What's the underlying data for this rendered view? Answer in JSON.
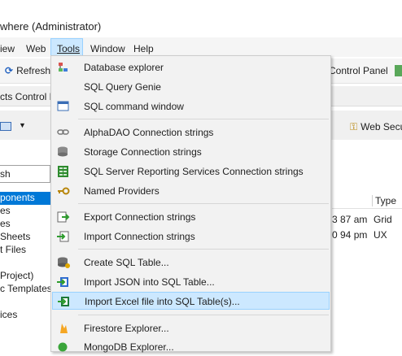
{
  "window": {
    "title": "where (Administrator)"
  },
  "menubar": {
    "items": [
      {
        "label": "iew"
      },
      {
        "label": "Web"
      },
      {
        "label": "Tools"
      },
      {
        "label": "Window"
      },
      {
        "label": "Help"
      }
    ]
  },
  "toolbar": {
    "refresh_label": "Refresh",
    "control_panel_label": "Control Panel"
  },
  "tabstrip": {
    "tab_label": "cts Control Pa"
  },
  "toolbar2": {
    "web_security_label": "Web Secu"
  },
  "search": {
    "value": "sh"
  },
  "left_panel": {
    "items": [
      {
        "label": "ponents"
      },
      {
        "label": "es"
      },
      {
        "label": "es"
      },
      {
        "label": " Sheets"
      },
      {
        "label": "t Files"
      },
      {
        "label": ""
      },
      {
        "label": "Project)"
      },
      {
        "label": "c Templates"
      },
      {
        "label": ""
      },
      {
        "label": "ices"
      }
    ]
  },
  "grid": {
    "type_header": "Type",
    "rows": [
      {
        "time": "3 87 am",
        "type": "Grid"
      },
      {
        "time": "0 94 pm",
        "type": "UX"
      }
    ]
  },
  "tools_menu": {
    "items": [
      {
        "label": "Database explorer",
        "icon": "database-explorer-icon"
      },
      {
        "label": "SQL Query Genie",
        "icon": ""
      },
      {
        "label": "SQL command window",
        "icon": "sql-window-icon"
      },
      {
        "label": "AlphaDAO Connection strings",
        "icon": "link-icon"
      },
      {
        "label": "Storage Connection strings",
        "icon": "storage-icon"
      },
      {
        "label": "SQL Server Reporting Services Connection strings",
        "icon": "report-icon"
      },
      {
        "label": "Named Providers",
        "icon": "key-icon"
      },
      {
        "label": "Export Connection strings",
        "icon": "export-icon"
      },
      {
        "label": "Import Connection strings",
        "icon": "import-icon"
      },
      {
        "label": "Create SQL Table...",
        "icon": "create-table-icon"
      },
      {
        "label": "Import JSON into SQL Table...",
        "icon": "import-json-icon"
      },
      {
        "label": "Import Excel file into SQL Table(s)...",
        "icon": "import-excel-icon"
      },
      {
        "label": "Firestore Explorer...",
        "icon": "firestore-icon"
      },
      {
        "label": "MongoDB Explorer...",
        "icon": "mongodb-icon"
      }
    ]
  },
  "colors": {
    "selection": "#0078d7",
    "menu_highlight": "#cce8ff",
    "menu_background": "#f2f2f2"
  }
}
